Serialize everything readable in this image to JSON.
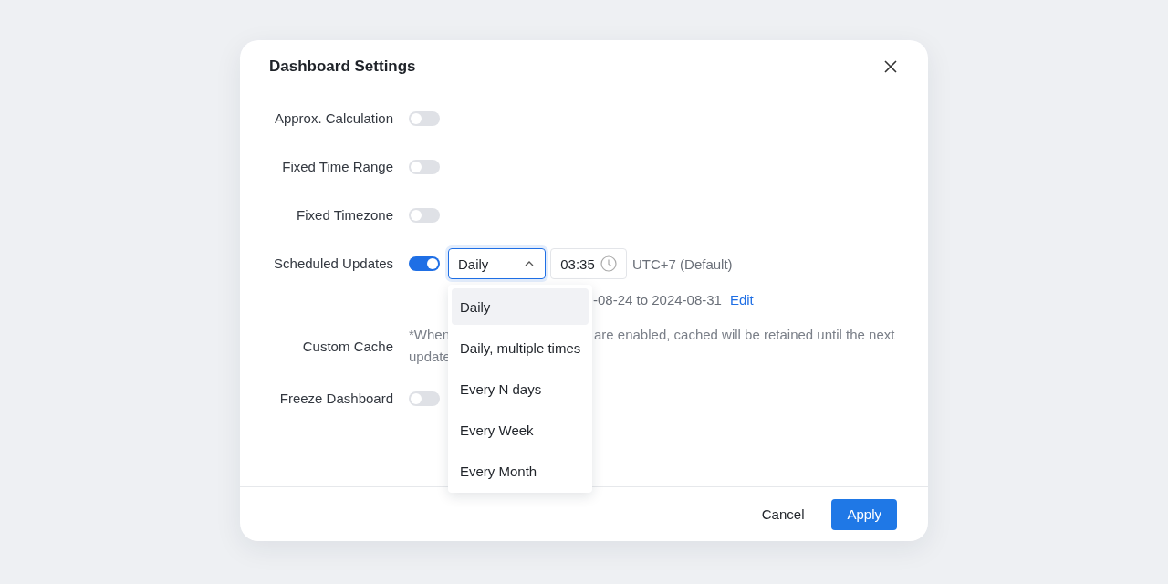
{
  "dialog": {
    "title": "Dashboard Settings"
  },
  "settings": [
    {
      "kind": "toggle",
      "label": "Approx. Calculation",
      "on": false
    },
    {
      "kind": "toggle",
      "label": "Fixed Time Range",
      "on": false
    },
    {
      "kind": "toggle",
      "label": "Fixed Timezone",
      "on": false
    },
    {
      "kind": "schedule",
      "label": "Scheduled Updates",
      "on": true,
      "frequency": {
        "value": "Daily",
        "expanded": true,
        "options": [
          {
            "label": "Daily",
            "selected": true
          },
          {
            "label": "Daily, multiple times",
            "selected": false
          },
          {
            "label": "Every N days",
            "selected": false
          },
          {
            "label": "Every Week",
            "selected": false
          },
          {
            "label": "Every Month",
            "selected": false
          }
        ]
      },
      "time": "03:35",
      "timezone": "UTC+7 (Default)",
      "note_end": "-08-24 to 2024-08-31",
      "edit_link": "Edit"
    },
    {
      "kind": "note",
      "label": "Custom Cache",
      "lines": [
        [
          "*When",
          "are enabled, cached will be retained until the next"
        ],
        [
          "update"
        ]
      ]
    },
    {
      "kind": "toggle",
      "label": "Freeze Dashboard",
      "on": false
    }
  ],
  "buttons": [
    {
      "label": "Cancel",
      "kind": "secondary"
    },
    {
      "label": "Apply",
      "kind": "primary"
    }
  ]
}
